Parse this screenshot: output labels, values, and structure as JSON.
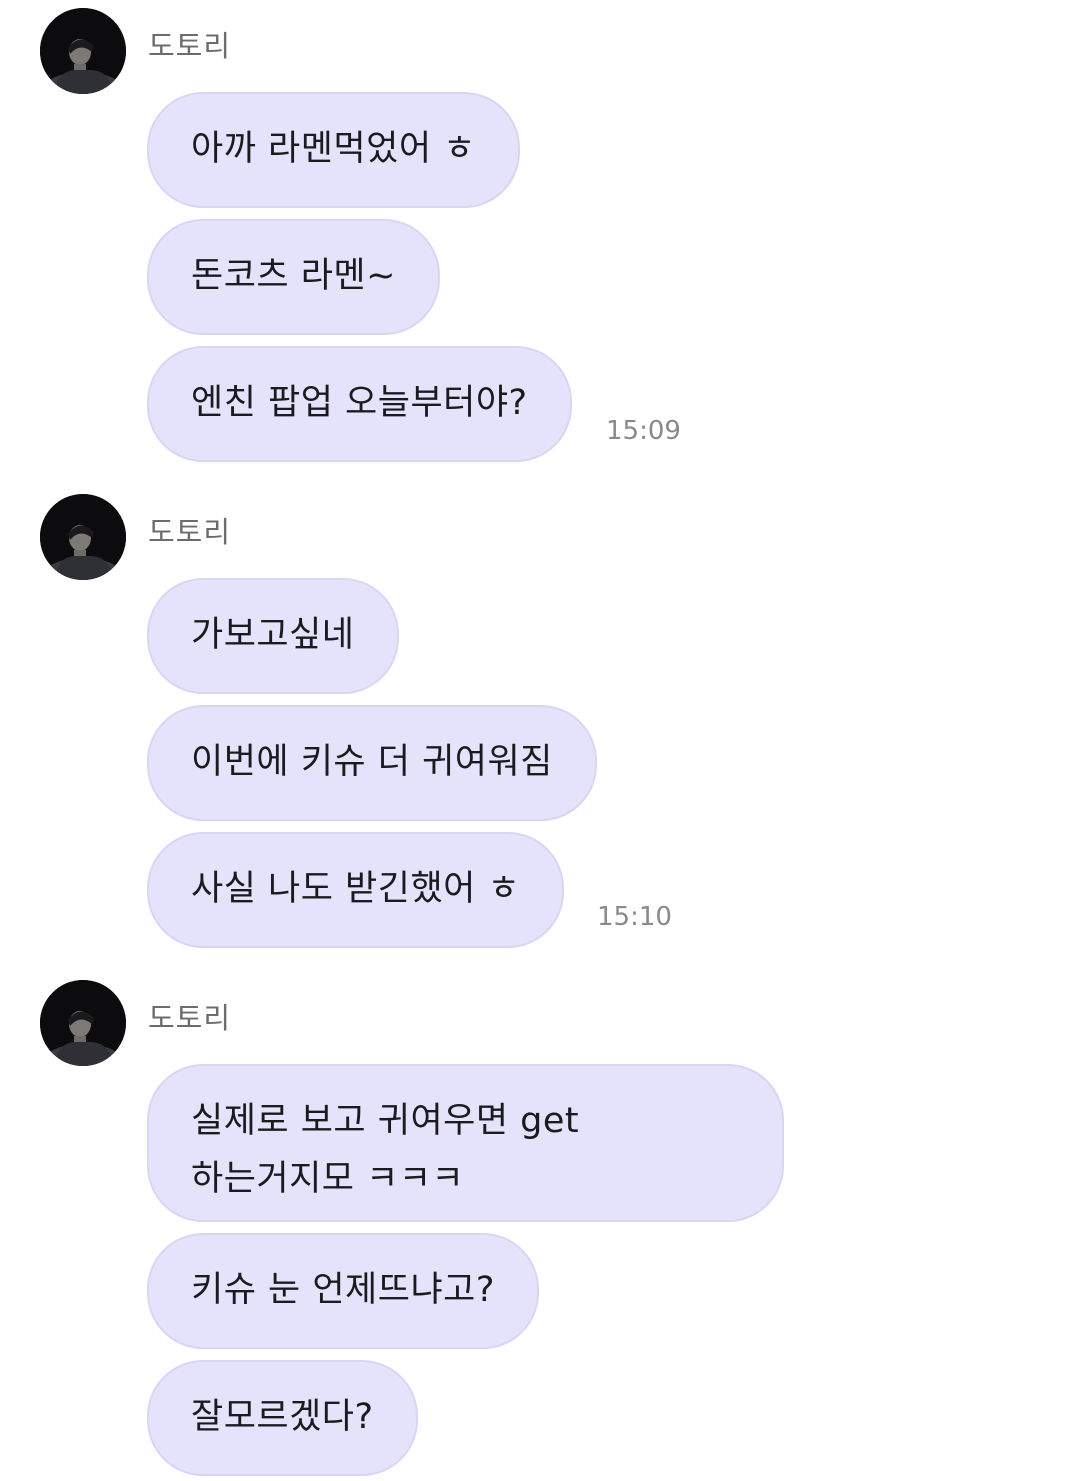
{
  "messages": [
    {
      "sender": "도토리",
      "avatar": "profile-photo",
      "bubbles": [
        "아까 라멘먹었어 ㅎ",
        "돈코츠 라멘~",
        "엔친 팝업 오늘부터야?"
      ],
      "time": "15:09"
    },
    {
      "sender": "도토리",
      "avatar": "profile-photo",
      "bubbles": [
        "가보고싶네",
        "이번에 키슈 더 귀여워짐",
        "사실 나도 받긴했어 ㅎ"
      ],
      "time": "15:10"
    },
    {
      "sender": "도토리",
      "avatar": "profile-photo",
      "bubbles": [
        "실제로 보고 귀여우면 get\n하는거지모 ㅋㅋㅋ",
        "키슈 눈 언제뜨냐고?",
        "잘모르겠다?"
      ]
    }
  ],
  "colors": {
    "bubble_bg": "#e5e3fb",
    "bubble_border": "#d9d6f4",
    "sender_text": "#6c6c70",
    "time_text": "#8a8a8e"
  }
}
